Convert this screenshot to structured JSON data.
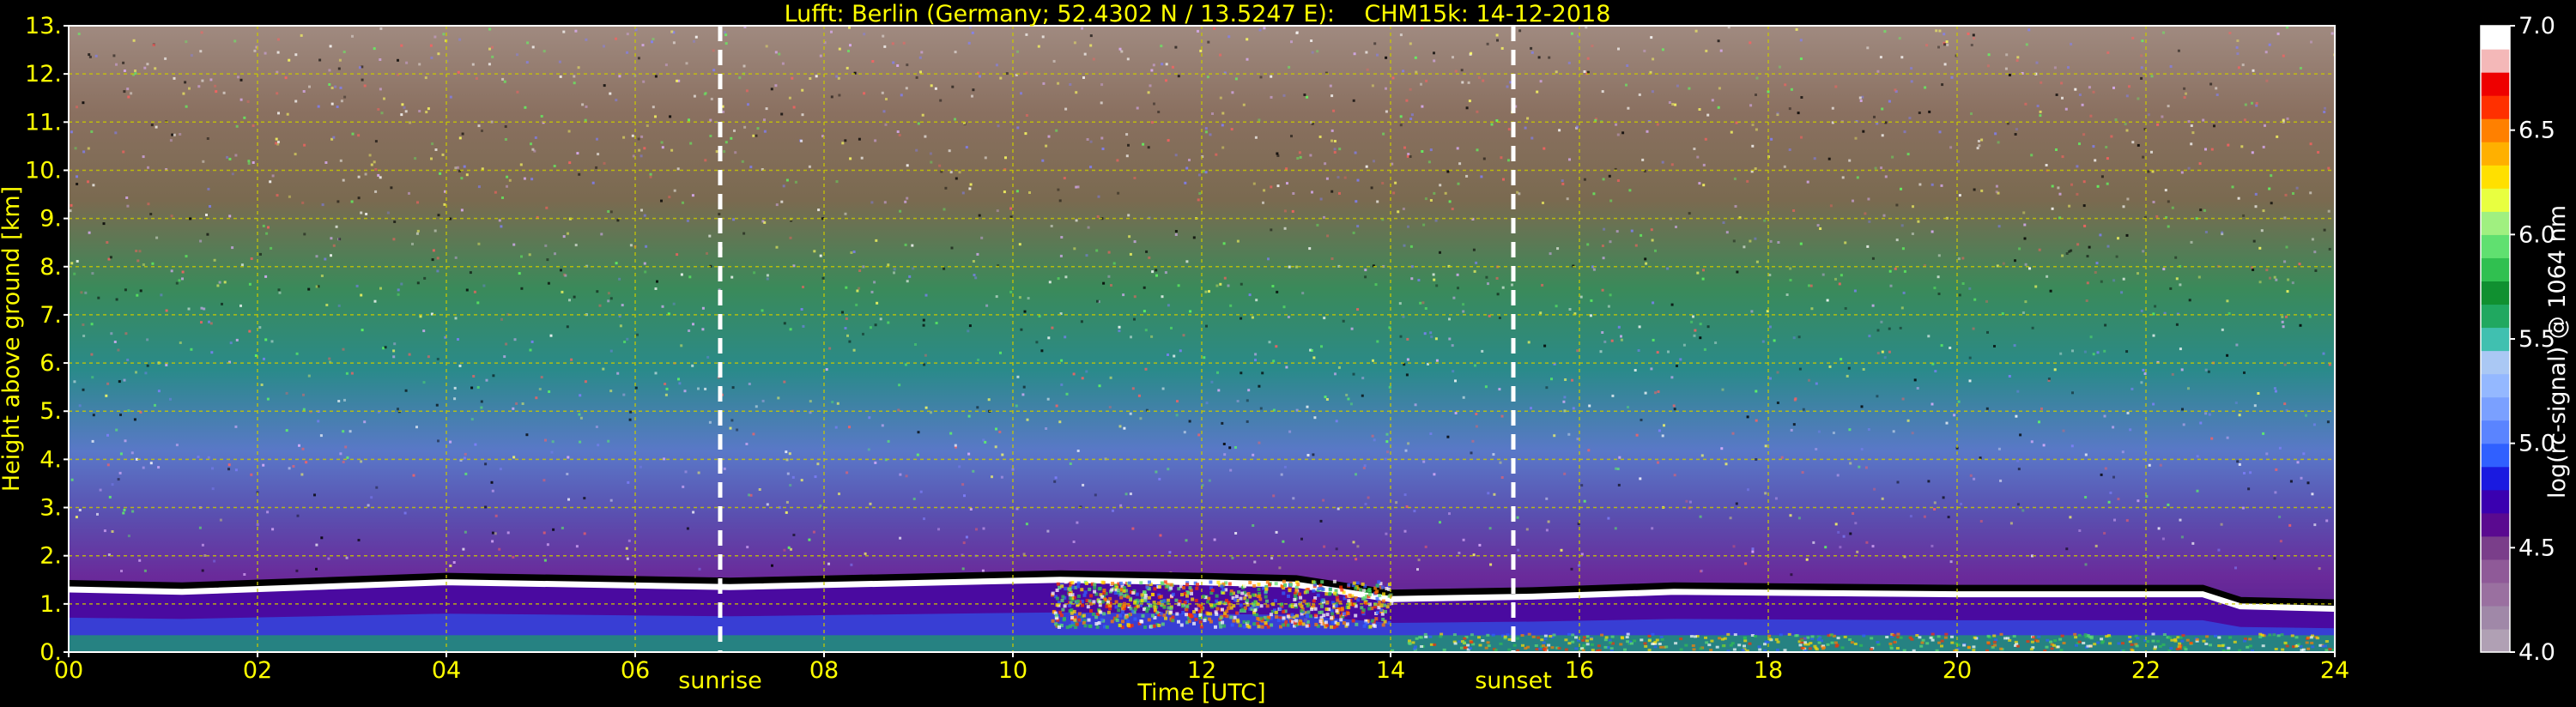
{
  "chart_data": {
    "type": "heatmap",
    "title": "Lufft: Berlin (Germany; 52.4302 N / 13.5247 E):    CHM15k: 14-12-2018",
    "xlabel": "Time [UTC]",
    "ylabel": "Height above ground [km]",
    "xlim": [
      0,
      24
    ],
    "ylim": [
      0,
      13
    ],
    "x_ticks": [
      "00",
      "02",
      "04",
      "06",
      "08",
      "10",
      "12",
      "14",
      "16",
      "18",
      "20",
      "22",
      "24"
    ],
    "x_tick_values": [
      0,
      2,
      4,
      6,
      8,
      10,
      12,
      14,
      16,
      18,
      20,
      22,
      24
    ],
    "y_ticks": [
      "0.",
      "1.",
      "2.",
      "3.",
      "4.",
      "5.",
      "6.",
      "7.",
      "8.",
      "9.",
      "10.",
      "11.",
      "12.",
      "13."
    ],
    "y_tick_values": [
      0,
      1,
      2,
      3,
      4,
      5,
      6,
      7,
      8,
      9,
      10,
      11,
      12,
      13
    ],
    "grid": true,
    "markers": [
      {
        "label": "sunrise",
        "time": 6.9
      },
      {
        "label": "sunset",
        "time": 15.3
      }
    ],
    "colorbar": {
      "label": "log(rc-signal) @ 1064 nm",
      "min": 4.0,
      "max": 7.0,
      "ticks": [
        "4.0",
        "4.5",
        "5.0",
        "5.5",
        "6.0",
        "6.5",
        "7.0"
      ],
      "tick_values": [
        4.0,
        4.5,
        5.0,
        5.5,
        6.0,
        6.5,
        7.0
      ],
      "colors": [
        "#b0a0b4",
        "#a088a8",
        "#9a70a0",
        "#8f5a98",
        "#7a3e8a",
        "#5a0a90",
        "#3a00b0",
        "#1a1ae0",
        "#3060ff",
        "#5a84ff",
        "#7aa0ff",
        "#94b8ff",
        "#aac8f4",
        "#40c0b0",
        "#20a860",
        "#109030",
        "#30c050",
        "#60e070",
        "#a0f080",
        "#e8ff40",
        "#ffe000",
        "#ffb000",
        "#ff8000",
        "#ff3000",
        "#ee0000",
        "#f4b8b8",
        "#ffffff"
      ]
    },
    "mixing_layer_top_km": [
      {
        "time": 0,
        "height": 1.3
      },
      {
        "time": 1.2,
        "height": 1.25
      },
      {
        "time": 4.0,
        "height": 1.45
      },
      {
        "time": 7.0,
        "height": 1.35
      },
      {
        "time": 10.5,
        "height": 1.5
      },
      {
        "time": 12.0,
        "height": 1.45
      },
      {
        "time": 13.0,
        "height": 1.4
      },
      {
        "time": 14.0,
        "height": 1.1
      },
      {
        "time": 15.5,
        "height": 1.15
      },
      {
        "time": 17.0,
        "height": 1.25
      },
      {
        "time": 20.0,
        "height": 1.2
      },
      {
        "time": 22.6,
        "height": 1.2
      },
      {
        "time": 23.0,
        "height": 0.95
      },
      {
        "time": 24.0,
        "height": 0.9
      }
    ]
  },
  "title": "Lufft: Berlin (Germany; 52.4302 N / 13.5247 E):    CHM15k: 14-12-2018",
  "xlabel": "Time [UTC]",
  "ylabel": "Height above ground [km]",
  "colorbar_label": "log(rc-signal) @ 1064 nm",
  "sunrise_label": "sunrise",
  "sunset_label": "sunset",
  "colors": {
    "background": "#000000",
    "text": "#ffff00",
    "grid": "#c8c800",
    "marker": "#ffffff"
  }
}
